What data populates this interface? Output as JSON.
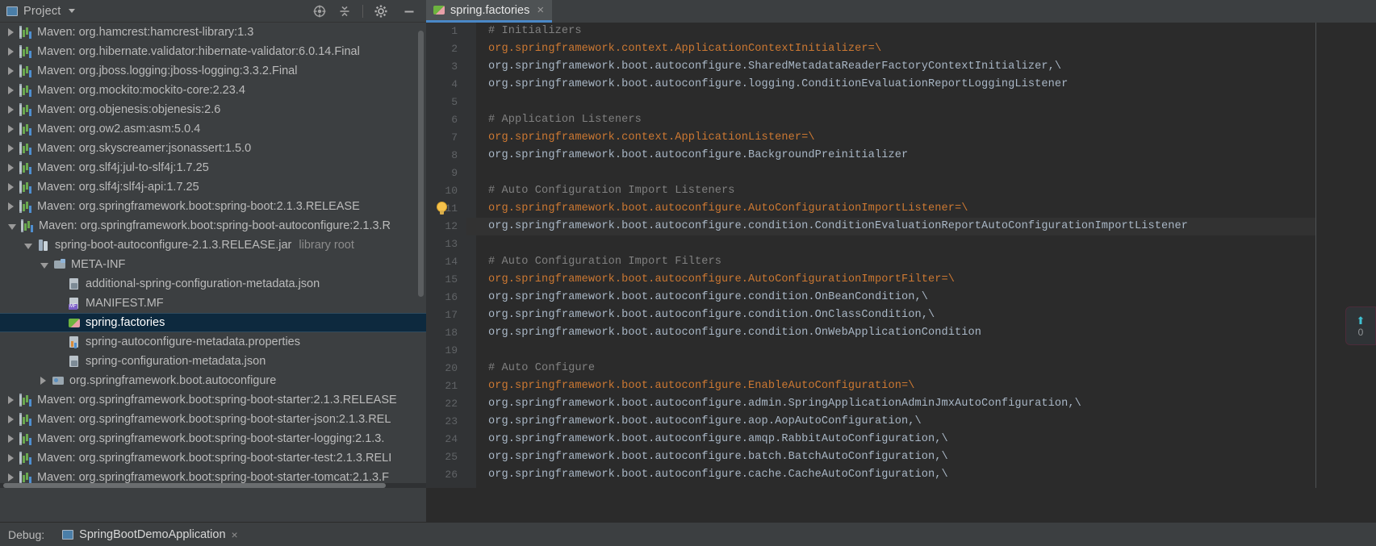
{
  "project_panel": {
    "title": "Project",
    "toolbar_icons": [
      "locate-target-icon",
      "collapse-all-icon",
      "settings-gear-icon",
      "minimize-icon"
    ],
    "tree": [
      {
        "label": "Maven: org.hamcrest:hamcrest-library:1.3",
        "indent": 0,
        "arrow": "collapsed",
        "icon": "maven-icon"
      },
      {
        "label": "Maven: org.hibernate.validator:hibernate-validator:6.0.14.Final",
        "indent": 0,
        "arrow": "collapsed",
        "icon": "maven-icon"
      },
      {
        "label": "Maven: org.jboss.logging:jboss-logging:3.3.2.Final",
        "indent": 0,
        "arrow": "collapsed",
        "icon": "maven-icon"
      },
      {
        "label": "Maven: org.mockito:mockito-core:2.23.4",
        "indent": 0,
        "arrow": "collapsed",
        "icon": "maven-icon"
      },
      {
        "label": "Maven: org.objenesis:objenesis:2.6",
        "indent": 0,
        "arrow": "collapsed",
        "icon": "maven-icon"
      },
      {
        "label": "Maven: org.ow2.asm:asm:5.0.4",
        "indent": 0,
        "arrow": "collapsed",
        "icon": "maven-icon"
      },
      {
        "label": "Maven: org.skyscreamer:jsonassert:1.5.0",
        "indent": 0,
        "arrow": "collapsed",
        "icon": "maven-icon"
      },
      {
        "label": "Maven: org.slf4j:jul-to-slf4j:1.7.25",
        "indent": 0,
        "arrow": "collapsed",
        "icon": "maven-icon"
      },
      {
        "label": "Maven: org.slf4j:slf4j-api:1.7.25",
        "indent": 0,
        "arrow": "collapsed",
        "icon": "maven-icon"
      },
      {
        "label": "Maven: org.springframework.boot:spring-boot:2.1.3.RELEASE",
        "indent": 0,
        "arrow": "collapsed",
        "icon": "maven-icon"
      },
      {
        "label": "Maven: org.springframework.boot:spring-boot-autoconfigure:2.1.3.R",
        "indent": 0,
        "arrow": "expanded",
        "icon": "maven-icon"
      },
      {
        "label": "spring-boot-autoconfigure-2.1.3.RELEASE.jar",
        "suffix": "library root",
        "indent": 1,
        "arrow": "expanded",
        "icon": "jar-icon"
      },
      {
        "label": "META-INF",
        "indent": 2,
        "arrow": "expanded",
        "icon": "folder-icon"
      },
      {
        "label": "additional-spring-configuration-metadata.json",
        "indent": 3,
        "arrow": "none",
        "icon": "json-file-icon"
      },
      {
        "label": "MANIFEST.MF",
        "indent": 3,
        "arrow": "none",
        "icon": "manifest-file-icon"
      },
      {
        "label": "spring.factories",
        "indent": 3,
        "arrow": "none",
        "icon": "spring-file-icon",
        "selected": true
      },
      {
        "label": "spring-autoconfigure-metadata.properties",
        "indent": 3,
        "arrow": "none",
        "icon": "properties-file-icon"
      },
      {
        "label": "spring-configuration-metadata.json",
        "indent": 3,
        "arrow": "none",
        "icon": "json-file-icon"
      },
      {
        "label": "org.springframework.boot.autoconfigure",
        "indent": 2,
        "arrow": "collapsed",
        "icon": "package-icon"
      },
      {
        "label": "Maven: org.springframework.boot:spring-boot-starter:2.1.3.RELEASE",
        "indent": 0,
        "arrow": "collapsed",
        "icon": "maven-icon"
      },
      {
        "label": "Maven: org.springframework.boot:spring-boot-starter-json:2.1.3.REL",
        "indent": 0,
        "arrow": "collapsed",
        "icon": "maven-icon"
      },
      {
        "label": "Maven: org.springframework.boot:spring-boot-starter-logging:2.1.3.",
        "indent": 0,
        "arrow": "collapsed",
        "icon": "maven-icon"
      },
      {
        "label": "Maven: org.springframework.boot:spring-boot-starter-test:2.1.3.RELI",
        "indent": 0,
        "arrow": "collapsed",
        "icon": "maven-icon"
      },
      {
        "label": "Maven: org.springframework.boot:spring-boot-starter-tomcat:2.1.3.F",
        "indent": 0,
        "arrow": "collapsed",
        "icon": "maven-icon"
      }
    ]
  },
  "editor": {
    "tab": {
      "title": "spring.factories",
      "icon": "spring-file-icon",
      "close": "×"
    },
    "lines": [
      {
        "n": "1",
        "segments": [
          {
            "t": "# Initializers",
            "c": "c-comment"
          }
        ]
      },
      {
        "n": "2",
        "segments": [
          {
            "t": "org.springframework.context.ApplicationContextInitializer=\\",
            "c": "c-key"
          }
        ]
      },
      {
        "n": "3",
        "segments": [
          {
            "t": "org.springframework.boot.autoconfigure.SharedMetadataReaderFactoryContextInitializer,\\",
            "c": "c-val"
          }
        ]
      },
      {
        "n": "4",
        "segments": [
          {
            "t": "org.springframework.boot.autoconfigure.logging.ConditionEvaluationReportLoggingListener",
            "c": "c-val"
          }
        ]
      },
      {
        "n": "5",
        "segments": [
          {
            "t": "",
            "c": "c-val"
          }
        ]
      },
      {
        "n": "6",
        "segments": [
          {
            "t": "# Application Listeners",
            "c": "c-comment"
          }
        ]
      },
      {
        "n": "7",
        "segments": [
          {
            "t": "org.springframework.context.ApplicationListener=\\",
            "c": "c-key"
          }
        ]
      },
      {
        "n": "8",
        "segments": [
          {
            "t": "org.springframework.boot.autoconfigure.BackgroundPreinitializer",
            "c": "c-val"
          }
        ]
      },
      {
        "n": "9",
        "segments": [
          {
            "t": "",
            "c": "c-val"
          }
        ]
      },
      {
        "n": "10",
        "segments": [
          {
            "t": "# Auto Configuration Import Listeners",
            "c": "c-comment"
          }
        ]
      },
      {
        "n": "11",
        "segments": [
          {
            "t": "org.springframework.boot.autoconfigure.AutoConfigurationImportListener=\\",
            "c": "c-key"
          }
        ]
      },
      {
        "n": "12",
        "segments": [
          {
            "t": "org.springframework.boot.autoconfigure.condition.ConditionEvaluationReportAutoConfigurationImportListener",
            "c": "c-val"
          }
        ],
        "highlight": true
      },
      {
        "n": "13",
        "segments": [
          {
            "t": "",
            "c": "c-val"
          }
        ]
      },
      {
        "n": "14",
        "segments": [
          {
            "t": "# Auto Configuration Import Filters",
            "c": "c-comment"
          }
        ]
      },
      {
        "n": "15",
        "segments": [
          {
            "t": "org.springframework.boot.autoconfigure.AutoConfigurationImportFilter=\\",
            "c": "c-key"
          }
        ]
      },
      {
        "n": "16",
        "segments": [
          {
            "t": "org.springframework.boot.autoconfigure.condition.OnBeanCondition,\\",
            "c": "c-val"
          }
        ]
      },
      {
        "n": "17",
        "segments": [
          {
            "t": "org.springframework.boot.autoconfigure.condition.OnClassCondition,\\",
            "c": "c-val"
          }
        ]
      },
      {
        "n": "18",
        "segments": [
          {
            "t": "org.springframework.boot.autoconfigure.condition.OnWebApplicationCondition",
            "c": "c-val"
          }
        ]
      },
      {
        "n": "19",
        "segments": [
          {
            "t": "",
            "c": "c-val"
          }
        ]
      },
      {
        "n": "20",
        "segments": [
          {
            "t": "# Auto Configure",
            "c": "c-comment"
          }
        ]
      },
      {
        "n": "21",
        "segments": [
          {
            "t": "org.springframework.boot.autoconfigure.EnableAutoConfiguration=\\",
            "c": "c-key"
          }
        ]
      },
      {
        "n": "22",
        "segments": [
          {
            "t": "org.springframework.boot.autoconfigure.admin.SpringApplicationAdminJmxAutoConfiguration,\\",
            "c": "c-val"
          }
        ]
      },
      {
        "n": "23",
        "segments": [
          {
            "t": "org.springframework.boot.autoconfigure.aop.AopAutoConfiguration,\\",
            "c": "c-val"
          }
        ]
      },
      {
        "n": "24",
        "segments": [
          {
            "t": "org.springframework.boot.autoconfigure.amqp.RabbitAutoConfiguration,\\",
            "c": "c-val"
          }
        ]
      },
      {
        "n": "25",
        "segments": [
          {
            "t": "org.springframework.boot.autoconfigure.batch.BatchAutoConfiguration,\\",
            "c": "c-val"
          }
        ]
      },
      {
        "n": "26",
        "segments": [
          {
            "t": "org.springframework.boot.autoconfigure.cache.CacheAutoConfiguration,\\",
            "c": "c-val"
          }
        ]
      }
    ],
    "intention_bulb": "intention-lightbulb-icon",
    "notification_widget": {
      "arrow": "⬆",
      "count": "0"
    }
  },
  "bottom": {
    "debug_label": "Debug:",
    "run_config": "SpringBootDemoApplication",
    "close": "×"
  },
  "colors": {
    "accent": "#4a88c7",
    "selection": "#0d293e",
    "key": "#cc7832",
    "value": "#a9b7c6",
    "comment": "#808080",
    "editor_bg": "#2b2b2b",
    "panel_bg": "#3c3f41"
  }
}
